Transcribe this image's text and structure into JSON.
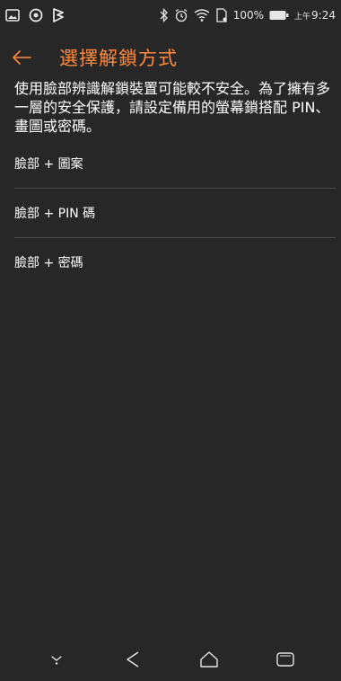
{
  "status_bar": {
    "left_icons": [
      "image-icon",
      "sync-icon",
      "flag-icon"
    ],
    "right_icons": [
      "bluetooth-icon",
      "alarm-icon",
      "wifi-icon",
      "sim-icon"
    ],
    "battery_percent": "100%",
    "clock_ampm": "上午",
    "clock_time": "9:24"
  },
  "app_bar": {
    "title": "選擇解鎖方式",
    "back_icon": "arrow-left-icon"
  },
  "description": "使用臉部辨識解鎖裝置可能較不安全。為了擁有多一層的安全保護，請設定備用的螢幕鎖搭配 PIN、畫圖或密碼。",
  "options": [
    {
      "label": "臉部 + 圖案"
    },
    {
      "label": "臉部 + PIN 碼"
    },
    {
      "label": "臉部 + 密碼"
    }
  ],
  "nav_bar": {
    "icons": [
      "collapse-icon",
      "back-icon",
      "home-icon",
      "recents-icon"
    ]
  },
  "colors": {
    "background": "#272727",
    "accent": "#ff8a3c",
    "text": "#ffffff",
    "divider": "#4a4a4a"
  }
}
